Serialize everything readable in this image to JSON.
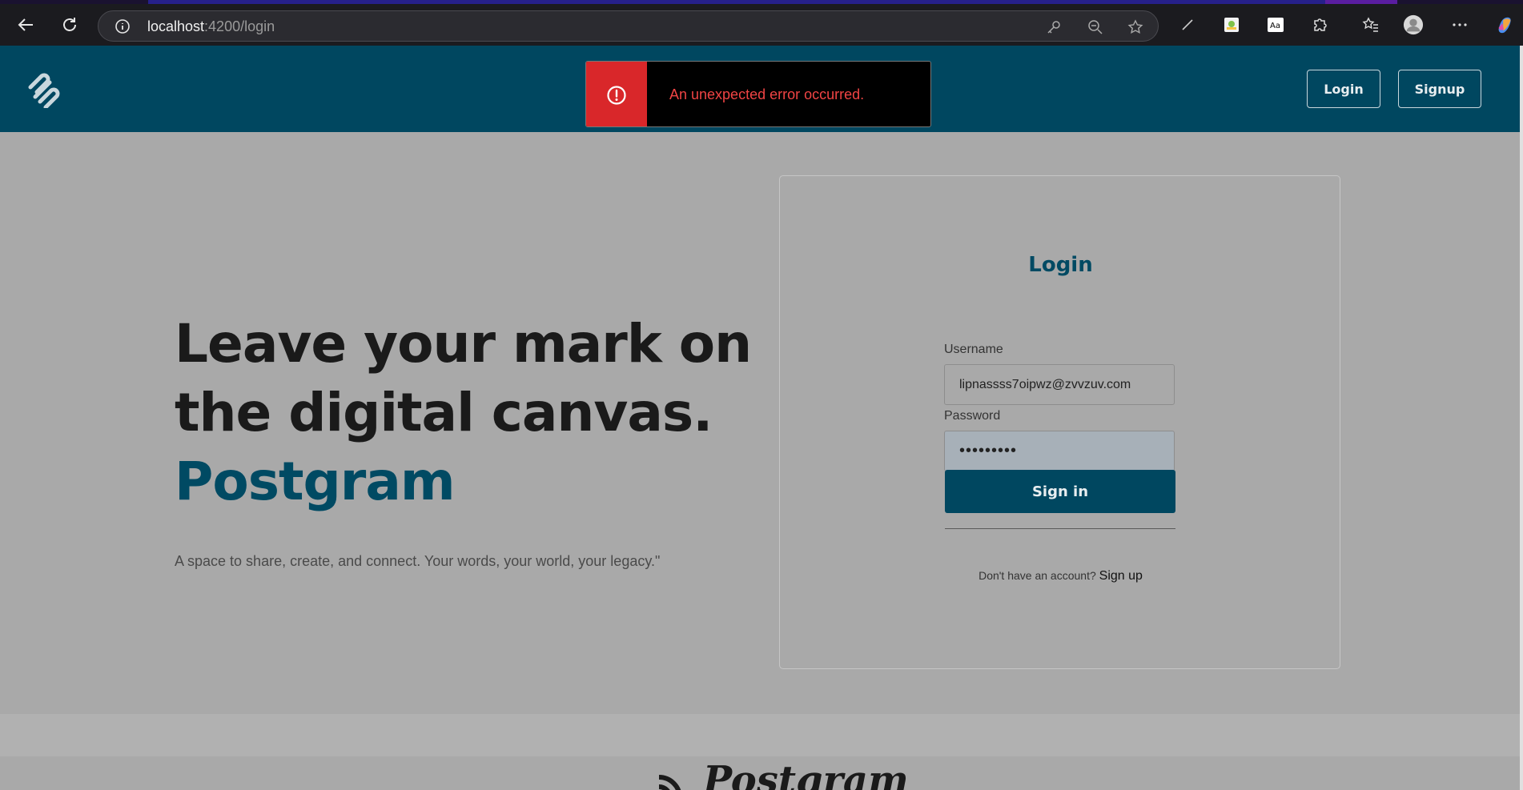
{
  "browser": {
    "url_host": "localhost",
    "url_path": ":4200/login"
  },
  "header": {
    "login_label": "Login",
    "signup_label": "Signup"
  },
  "toast": {
    "message": "An unexpected error occurred."
  },
  "hero": {
    "line1": "Leave your mark on",
    "line2": "the digital canvas.",
    "brand": "Postgram",
    "subtitle": "A space to share, create, and connect. Your words, your world, your legacy.\""
  },
  "login_form": {
    "title": "Login",
    "username_label": "Username",
    "username_value": "lipnassss7oipwz@zvvzuv.com",
    "password_label": "Password",
    "password_value": "•••••••••",
    "signin_label": "Sign in",
    "no_account_text": "Don't have an account?",
    "signup_link": "Sign up"
  },
  "footer": {
    "brand": "Postgram"
  },
  "colors": {
    "primary": "#004760",
    "error": "#d9272a",
    "overlay_bg": "#a9a9a9"
  }
}
